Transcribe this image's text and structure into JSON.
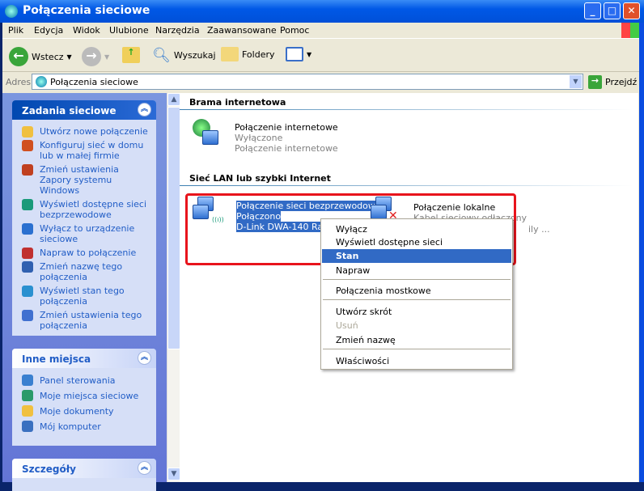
{
  "window": {
    "title": "Połączenia sieciowe",
    "controls": [
      "minimize",
      "maximize",
      "close"
    ]
  },
  "menu": [
    "Plik",
    "Edycja",
    "Widok",
    "Ulubione",
    "Narzędzia",
    "Zaawansowane",
    "Pomoc"
  ],
  "toolbar": {
    "back": "Wstecz",
    "search": "Wyszukaj",
    "folders": "Foldery"
  },
  "address": {
    "label": "Adres",
    "value": "Połączenia sieciowe",
    "go": "Przejdź"
  },
  "left": {
    "tasks": {
      "title": "Zadania sieciowe",
      "items": [
        "Utwórz nowe połączenie",
        "Konfiguruj sieć w domu lub w małej firmie",
        "Zmień ustawienia Zapory systemu Windows",
        "Wyświetl dostępne sieci bezprzewodowe",
        "Wyłącz to urządzenie sieciowe",
        "Napraw to połączenie",
        "Zmień nazwę tego połączenia",
        "Wyświetl stan tego połączenia",
        "Zmień ustawienia tego połączenia"
      ]
    },
    "other": {
      "title": "Inne miejsca",
      "items": [
        "Panel sterowania",
        "Moje miejsca sieciowe",
        "Moje dokumenty",
        "Mój komputer"
      ]
    },
    "details": {
      "title": "Szczegóły"
    }
  },
  "main": {
    "group1": "Brama internetowa",
    "inet": {
      "name": "Połączenie internetowe",
      "status": "Wyłączone",
      "type": "Połączenie internetowe"
    },
    "group2": "Sieć LAN lub szybki Internet",
    "wifi": {
      "name": "Połączenie sieci bezprzewodowej",
      "status": "Połączono",
      "device": "D-Link DWA-140 Ranc"
    },
    "lan": {
      "name": "Połączenie lokalne",
      "status": "Kabel sieciowy odłączony",
      "device": "ily ..."
    }
  },
  "context_menu": {
    "items": [
      "Wyłącz",
      "Wyświetl dostępne sieci bezprzewodowe",
      "Stan",
      "Napraw",
      "Połączenia mostkowe",
      "Utwórz skrót",
      "Usuń",
      "Zmień nazwę",
      "Właściwości"
    ],
    "selected": "Stan",
    "disabled": [
      "Usuń"
    ]
  },
  "colors": {
    "highlight": "#316ac5",
    "callout": "#e8141c",
    "link": "#215dc6"
  }
}
